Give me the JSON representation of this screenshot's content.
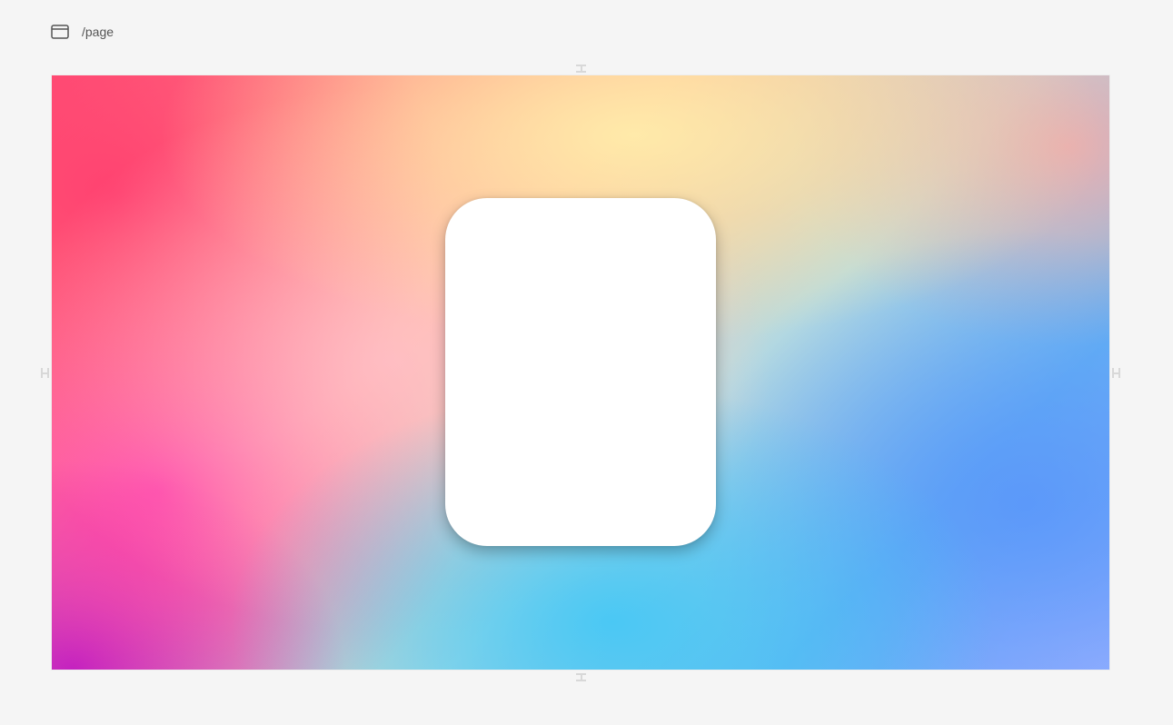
{
  "header": {
    "icon": "browser-window-icon",
    "path": "/page"
  },
  "colors": {
    "background": "#f5f5f5",
    "card": "#ffffff",
    "handle": "#d8d8d8"
  }
}
